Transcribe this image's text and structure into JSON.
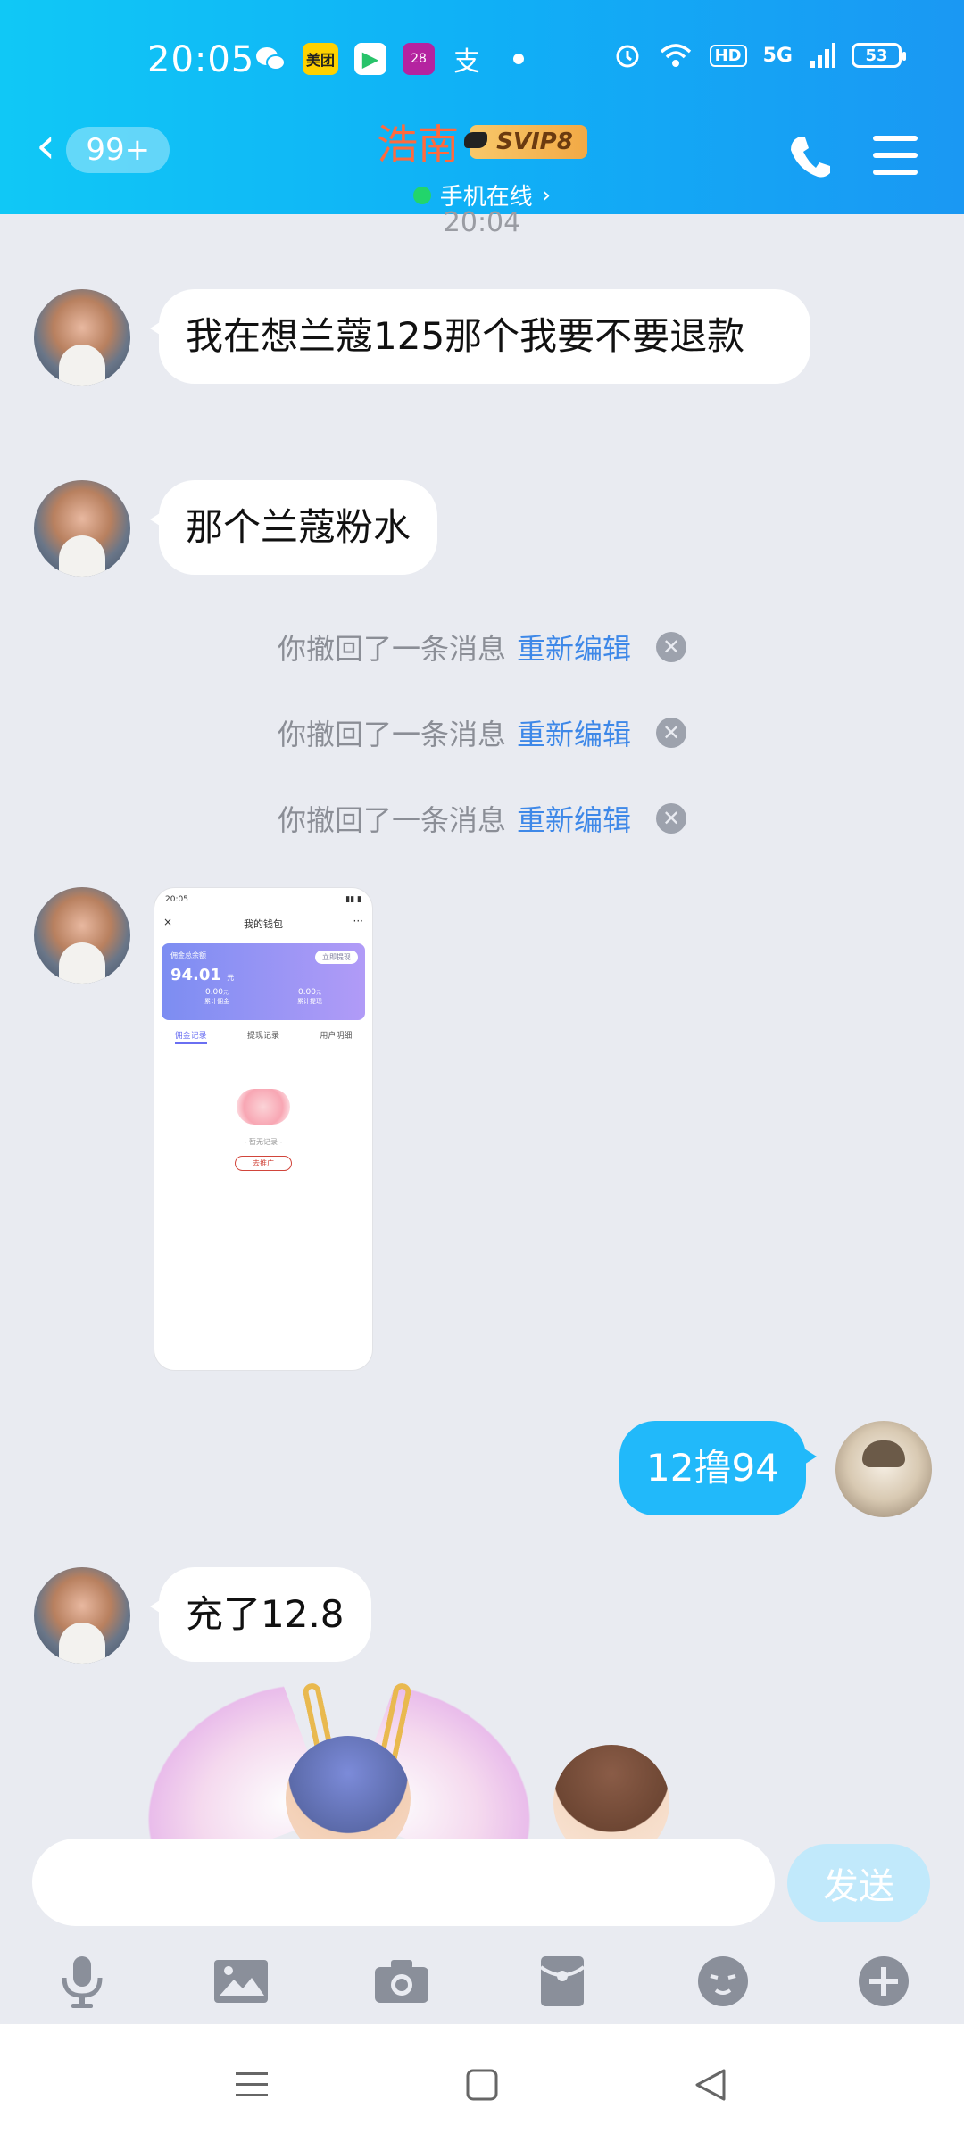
{
  "status_bar": {
    "time": "20:05",
    "left_icons": [
      "wechat-icon",
      "meituan-icon",
      "iqiyi-icon",
      "calendar-icon",
      "alipay-icon",
      "dot-icon"
    ],
    "calendar_day": "28",
    "meituan_label": "美团",
    "hd_label": "HD",
    "network_label": "5G",
    "battery": "53"
  },
  "header": {
    "unread_count": "99+",
    "contact_name": "浩南",
    "vip_badge": "SVIP8",
    "status_text": "手机在线",
    "status_chevron": "›",
    "colors": {
      "accent": "#12b7f5",
      "name": "#ff6a3d",
      "online": "#22d56b"
    }
  },
  "chat": {
    "timestamp": "20:04",
    "messages": [
      {
        "side": "left",
        "text": "我在想兰蔻125那个我要不要退款"
      },
      {
        "side": "left",
        "text": "那个兰蔻粉水"
      },
      {
        "side": "system",
        "text": "你撤回了一条消息",
        "action": "重新编辑"
      },
      {
        "side": "system",
        "text": "你撤回了一条消息",
        "action": "重新编辑"
      },
      {
        "side": "system",
        "text": "你撤回了一条消息",
        "action": "重新编辑"
      },
      {
        "side": "left",
        "type": "image",
        "image_content": {
          "time": "20:05",
          "title": "我的钱包",
          "card_label": "佣金总余额",
          "card_button": "立即提现",
          "balance": "94.01",
          "balance_unit": "元",
          "stats": [
            {
              "value": "0.00",
              "unit": "元",
              "label": "累计佣金"
            },
            {
              "value": "0.00",
              "unit": "元",
              "label": "累计提现"
            }
          ],
          "tabs": [
            "佣金记录",
            "提现记录",
            "用户明细"
          ],
          "empty_text": "- 暂无记录 -",
          "promote_button": "去推广"
        }
      },
      {
        "side": "right",
        "text": "12撸94"
      },
      {
        "side": "left",
        "text": "充了12.8"
      }
    ]
  },
  "input": {
    "placeholder": "",
    "send_label": "发送"
  },
  "toolbar": [
    "microphone-icon",
    "image-icon",
    "camera-icon",
    "red-packet-icon",
    "emoji-icon",
    "plus-icon"
  ],
  "navbar": [
    "menu-icon",
    "home-icon",
    "back-icon"
  ]
}
